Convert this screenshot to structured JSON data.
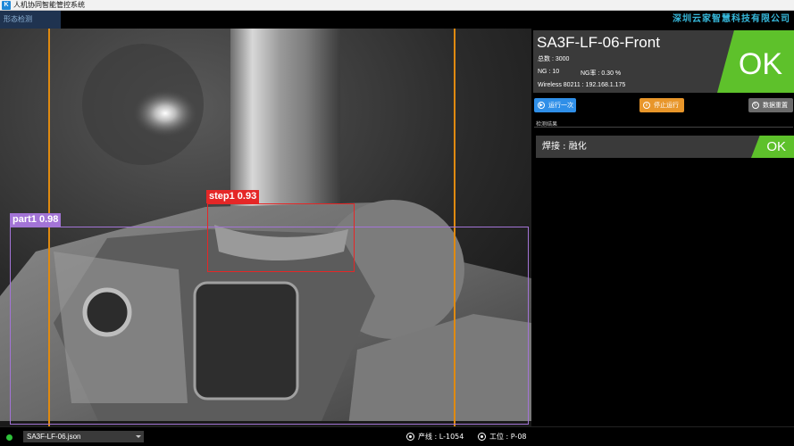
{
  "app": {
    "title": "人机协同智能管控系统",
    "logo_glyph": "K"
  },
  "header": {
    "tab_label": "形态检测",
    "company": "深圳云家智慧科技有限公司"
  },
  "detections": [
    {
      "label": "part1 0.98",
      "color": "#a374d6"
    },
    {
      "label": "step1 0.93",
      "color": "#e52727"
    }
  ],
  "panel": {
    "product": "SA3F-LF-06-Front",
    "total": "总数 : 3000",
    "ng_count": "NG : 10",
    "ng_rate": "NG率 : 0.30 %",
    "wireless": "Wireless 80211 : 192.168.1.175",
    "status": "OK",
    "buttons": {
      "run_once": "运行一次",
      "stop": "停止运行",
      "reset": "数据重置"
    },
    "section_title": "检测结果",
    "results": [
      {
        "text": "焊接 : 融化",
        "status": "OK"
      }
    ]
  },
  "statusbar": {
    "file": "SA3F-LF-06.json",
    "line": "产线 : L-1054",
    "station": "工位 : P-08"
  },
  "colors": {
    "ok_green": "#5ec12b",
    "guide_orange": "#e08a10",
    "accent_blue": "#2f8fe8"
  }
}
